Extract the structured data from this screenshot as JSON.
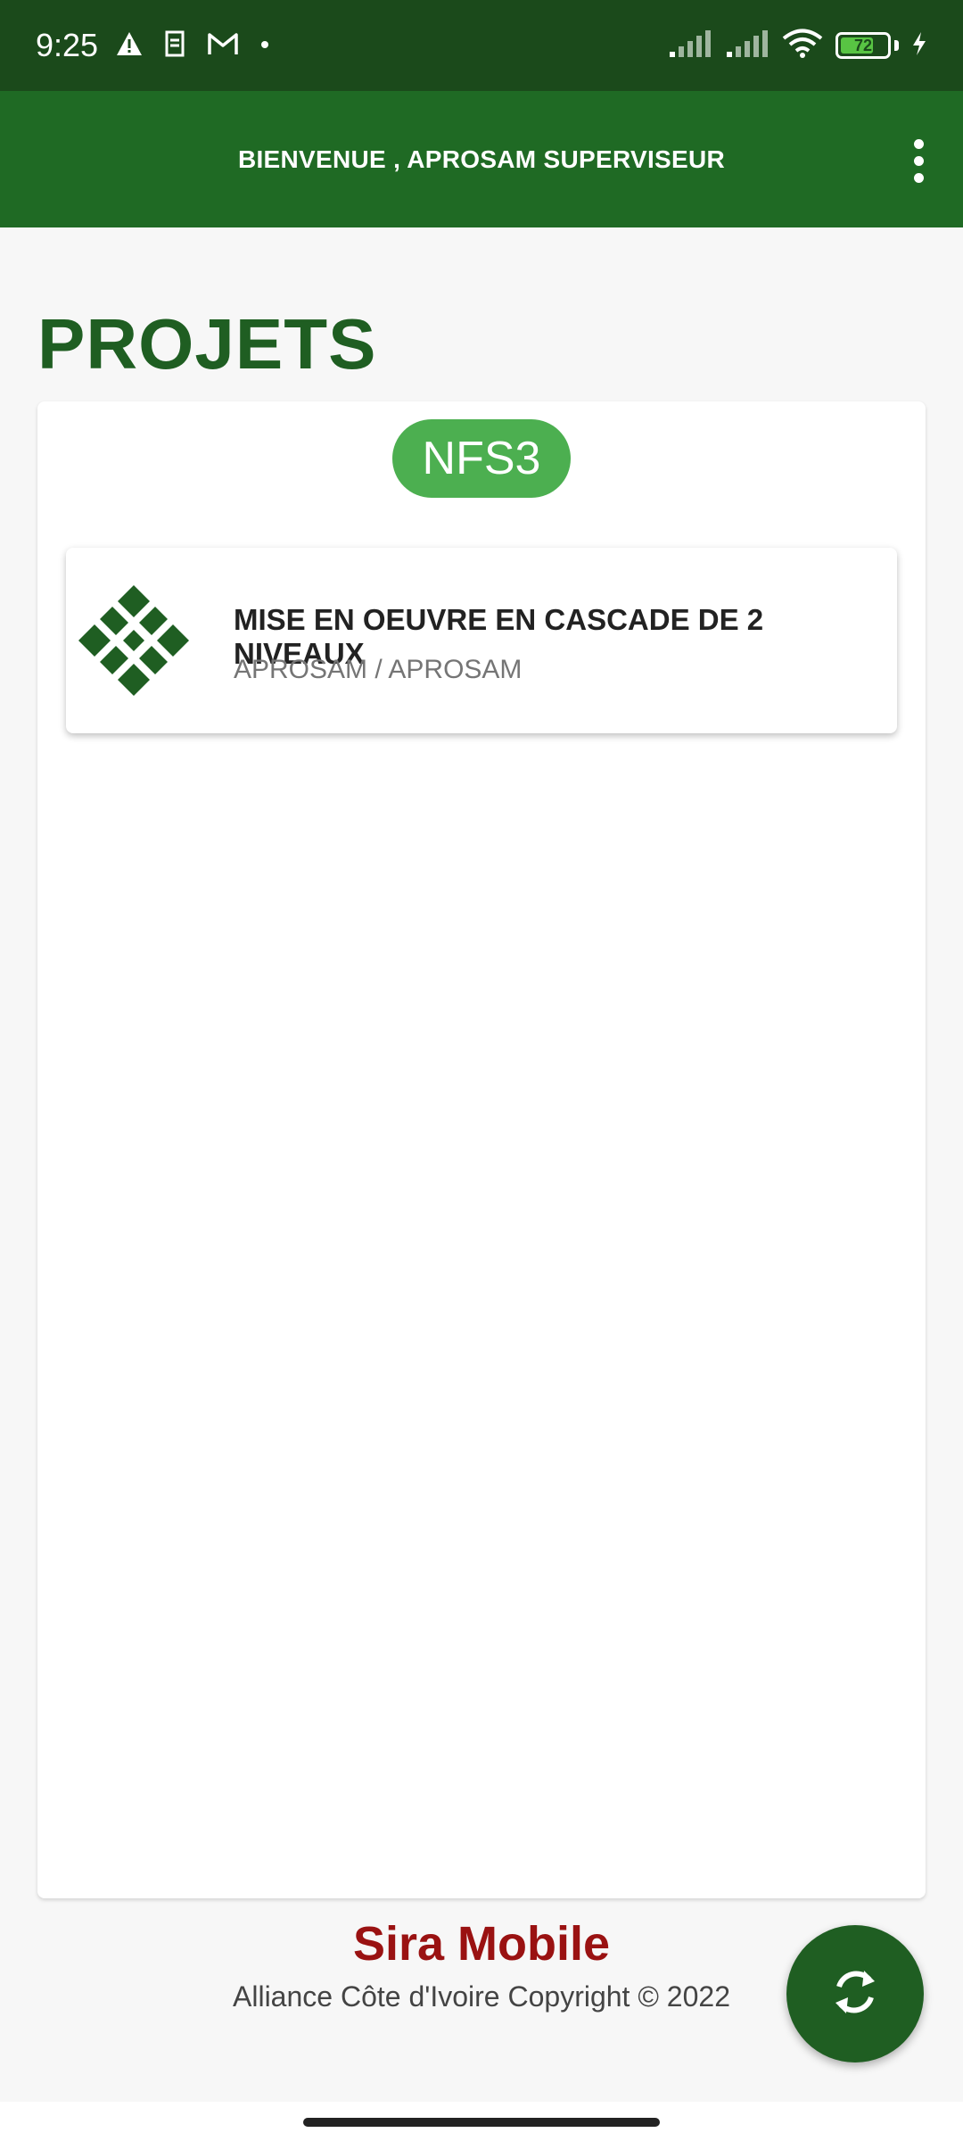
{
  "status_bar": {
    "time": "9:25",
    "icons_left": [
      "alert-icon",
      "sim-icon",
      "gmail-icon",
      "dot-icon"
    ],
    "icons_right": [
      "signal-icon",
      "signal-icon",
      "wifi-icon",
      "battery-icon",
      "charging-icon"
    ],
    "battery_level": "72",
    "battery_fraction": 0.72
  },
  "app_bar": {
    "title": "BIENVENUE , APROSAM SUPERVISEUR",
    "menu_icon": "more-vertical-icon"
  },
  "page": {
    "title": "PROJETS"
  },
  "card": {
    "chip_label": "NFS3",
    "projects": [
      {
        "name": "MISE EN OEUVRE EN CASCADE DE 2 NIVEAUX",
        "subtitle": "APROSAM / APROSAM",
        "icon": "project-logo-icon"
      }
    ]
  },
  "footer": {
    "brand": "Sira Mobile",
    "copyright": "Alliance Côte d'Ivoire Copyright © 2022"
  },
  "fab": {
    "icon": "sync-icon"
  },
  "colors": {
    "status_bar": "#1b4a1b",
    "app_bar": "#1f6a24",
    "primary_green": "#1f5e22",
    "chip_green": "#4caf50",
    "brand_red": "#9a1212"
  }
}
